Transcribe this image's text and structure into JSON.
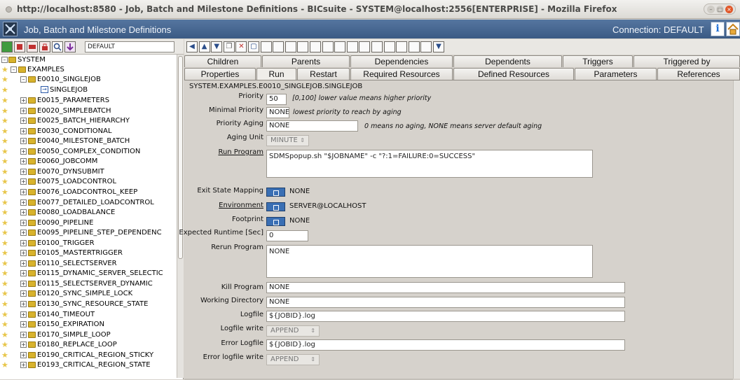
{
  "window": {
    "title": "http://localhost:8580 - Job, Batch and Milestone Definitions - BICsuite - SYSTEM@localhost:2556[ENTERPRISE] - Mozilla Firefox"
  },
  "app": {
    "title": "Job, Batch and Milestone Definitions",
    "connection": "Connection: DEFAULT",
    "info_label": "i"
  },
  "left_toolbar": {
    "filter_value": "DEFAULT"
  },
  "tree": {
    "system": "SYSTEM",
    "examples": "EXAMPLES",
    "e0010": "E0010_SINGLEJOB",
    "singlejob": "SINGLEJOB",
    "items": [
      "E0015_PARAMETERS",
      "E0020_SIMPLEBATCH",
      "E0025_BATCH_HIERARCHY",
      "E0030_CONDITIONAL",
      "E0040_MILESTONE_BATCH",
      "E0050_COMPLEX_CONDITION",
      "E0060_JOBCOMM",
      "E0070_DYNSUBMIT",
      "E0075_LOADCONTROL",
      "E0076_LOADCONTROL_KEEP",
      "E0077_DETAILED_LOADCONTROL",
      "E0080_LOADBALANCE",
      "E0090_PIPELINE",
      "E0095_PIPELINE_STEP_DEPENDENC",
      "E0100_TRIGGER",
      "E0105_MASTERTRIGGER",
      "E0110_SELECTSERVER",
      "E0115_DYNAMIC_SERVER_SELECTIC",
      "E0115_SELECTSERVER_DYNAMIC",
      "E0120_SYNC_SIMPLE_LOCK",
      "E0130_SYNC_RESOURCE_STATE",
      "E0140_TIMEOUT",
      "E0150_EXPIRATION",
      "E0170_SIMPLE_LOOP",
      "E0180_REPLACE_LOOP",
      "E0190_CRITICAL_REGION_STICKY",
      "E0193_CRITICAL_REGION_STATE"
    ]
  },
  "tabs_row1": [
    "Children",
    "Parents",
    "Dependencies",
    "Dependents",
    "Triggers",
    "Triggered by"
  ],
  "tabs_row2": [
    "Properties",
    "Run",
    "Restart",
    "Required Resources",
    "Defined Resources",
    "Parameters",
    "References"
  ],
  "form": {
    "path": "SYSTEM.EXAMPLES.E0010_SINGLEJOB.SINGLEJOB",
    "priority_label": "Priority",
    "priority_value": "50",
    "priority_hint": "[0,100] lower value means higher priority",
    "minpriority_label": "Minimal Priority",
    "minpriority_value": "NONE",
    "minpriority_hint": "lowest priority to reach by aging",
    "aging_label": "Priority Aging",
    "aging_value": "NONE",
    "aging_hint": "0 means no aging, NONE means server default aging",
    "agingunit_label": "Aging Unit",
    "agingunit_value": "MINUTE",
    "runprogram_label": "Run Program",
    "runprogram_value": "SDMSpopup.sh \"$JOBNAME\" -c \"?:1=FAILURE:0=SUCCESS\"",
    "exitstate_label": "Exit State Mapping",
    "exitstate_value": "NONE",
    "environment_label": "Environment",
    "environment_value": "SERVER@LOCALHOST",
    "footprint_label": "Footprint",
    "footprint_value": "NONE",
    "runtime_label": "Expected Runtime [Sec]",
    "runtime_value": "0",
    "rerun_label": "Rerun Program",
    "rerun_value": "NONE",
    "kill_label": "Kill Program",
    "kill_value": "NONE",
    "workdir_label": "Working Directory",
    "workdir_value": "NONE",
    "logfile_label": "Logfile",
    "logfile_value": "${JOBID}.log",
    "logwrite_label": "Logfile write",
    "logwrite_value": "APPEND",
    "errlog_label": "Error Logfile",
    "errlog_value": "${JOBID}.log",
    "errlogwrite_label": "Error logfile write",
    "errlogwrite_value": "APPEND"
  }
}
